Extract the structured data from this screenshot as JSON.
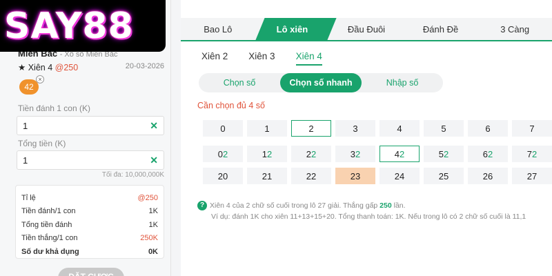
{
  "logo": {
    "text": "SAY88"
  },
  "bet": {
    "region": "Miền Bắc",
    "region_sub": "- Xổ số Miền Bắc",
    "name": "Xiên 4",
    "odds": "@250",
    "date": "20-03-2026",
    "chip": "42",
    "stake_label": "Tiền đánh 1 con (K)",
    "stake_value": "1",
    "total_label": "Tổng tiền (K)",
    "total_value": "1",
    "max_text": "Tối đa: 10,000,000K",
    "summary": [
      {
        "label": "Tỉ lệ",
        "value": "@250"
      },
      {
        "label": "Tiền đánh/1 con",
        "value": "1K"
      },
      {
        "label": "Tổng tiền đánh",
        "value": "1K"
      },
      {
        "label": "Tiền thắng/1 con",
        "value": "250K"
      },
      {
        "label": "Số dư khả dụng",
        "value": "0K"
      }
    ],
    "place_button": "ĐẶT CƯỢC"
  },
  "tabs": [
    "Bao Lô",
    "Lô xiên",
    "Đầu Đuôi",
    "Đánh Đề",
    "3 Càng"
  ],
  "subtabs": [
    "Xiên 2",
    "Xiên 3",
    "Xiên 4"
  ],
  "segments": [
    "Chọn số",
    "Chọn số nhanh",
    "Nhập số"
  ],
  "notice": "Cần chọn đủ 4 số",
  "row1": [
    "0",
    "1",
    "2",
    "3",
    "4",
    "5",
    "6",
    "7"
  ],
  "row2": [
    {
      "a": "0",
      "b": "2"
    },
    {
      "a": "1",
      "b": "2"
    },
    {
      "a": "2",
      "b": "2"
    },
    {
      "a": "3",
      "b": "2"
    },
    {
      "a": "4",
      "b": "2"
    },
    {
      "a": "5",
      "b": "2"
    },
    {
      "a": "6",
      "b": "2"
    },
    {
      "a": "7",
      "b": "2"
    }
  ],
  "row3": [
    "20",
    "21",
    "22",
    "23",
    "24",
    "25",
    "26",
    "27"
  ],
  "info": {
    "line1_pre": "Xiên 4 của 2 chữ số cuối trong lô 27 giải. Thắng gấp ",
    "line1_hl": "250",
    "line1_post": " lần.",
    "line2": "Ví dụ: đánh 1K cho xiên 11+13+15+20. Tổng thanh toán: 1K. Nếu trong lô có 2 chữ số cuối là 11,1"
  },
  "colors": {
    "accent": "#19a36c",
    "orange_chip": "#f0922c",
    "red": "#e0533a",
    "highlight_cell": "#f9d2b0"
  }
}
